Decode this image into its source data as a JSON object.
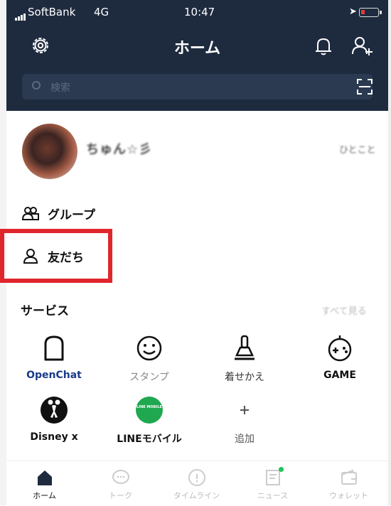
{
  "status_bar": {
    "carrier": "SoftBank",
    "network": "4G",
    "time": "10:47"
  },
  "header": {
    "title": "ホーム"
  },
  "search": {
    "placeholder": "検索"
  },
  "profile": {
    "name": "ちゅん☆彡",
    "status_message": "ひとこと"
  },
  "lists": {
    "groups_label": "グループ",
    "friends_label": "友だち"
  },
  "services": {
    "heading": "サービス",
    "see_all": "すべて見る",
    "items": [
      {
        "label": "OpenChat",
        "icon": "openchat-icon"
      },
      {
        "label": "スタンプ",
        "icon": "sticker-smiley-icon"
      },
      {
        "label": "着せかえ",
        "icon": "theme-brush-icon"
      },
      {
        "label": "GAME",
        "icon": "game-controller-icon"
      },
      {
        "label": "Disney x",
        "icon": "disney-mickey-icon"
      },
      {
        "label": "LINEモバイル",
        "icon": "line-mobile-icon",
        "icon_text": "LINE MOBILE"
      },
      {
        "label": "追加",
        "icon": "plus-icon"
      }
    ]
  },
  "tabs": [
    {
      "label": "ホーム",
      "icon": "home-icon",
      "active": true
    },
    {
      "label": "トーク",
      "icon": "chat-icon",
      "active": false
    },
    {
      "label": "タイムライン",
      "icon": "timeline-icon",
      "active": false
    },
    {
      "label": "ニュース",
      "icon": "news-icon",
      "active": false
    },
    {
      "label": "ウォレット",
      "icon": "wallet-icon",
      "active": false
    }
  ],
  "colors": {
    "header_bg": "#1e2b3f",
    "highlight": "#e0262d",
    "line_green": "#1fa84f",
    "badge": "#22c25a"
  }
}
